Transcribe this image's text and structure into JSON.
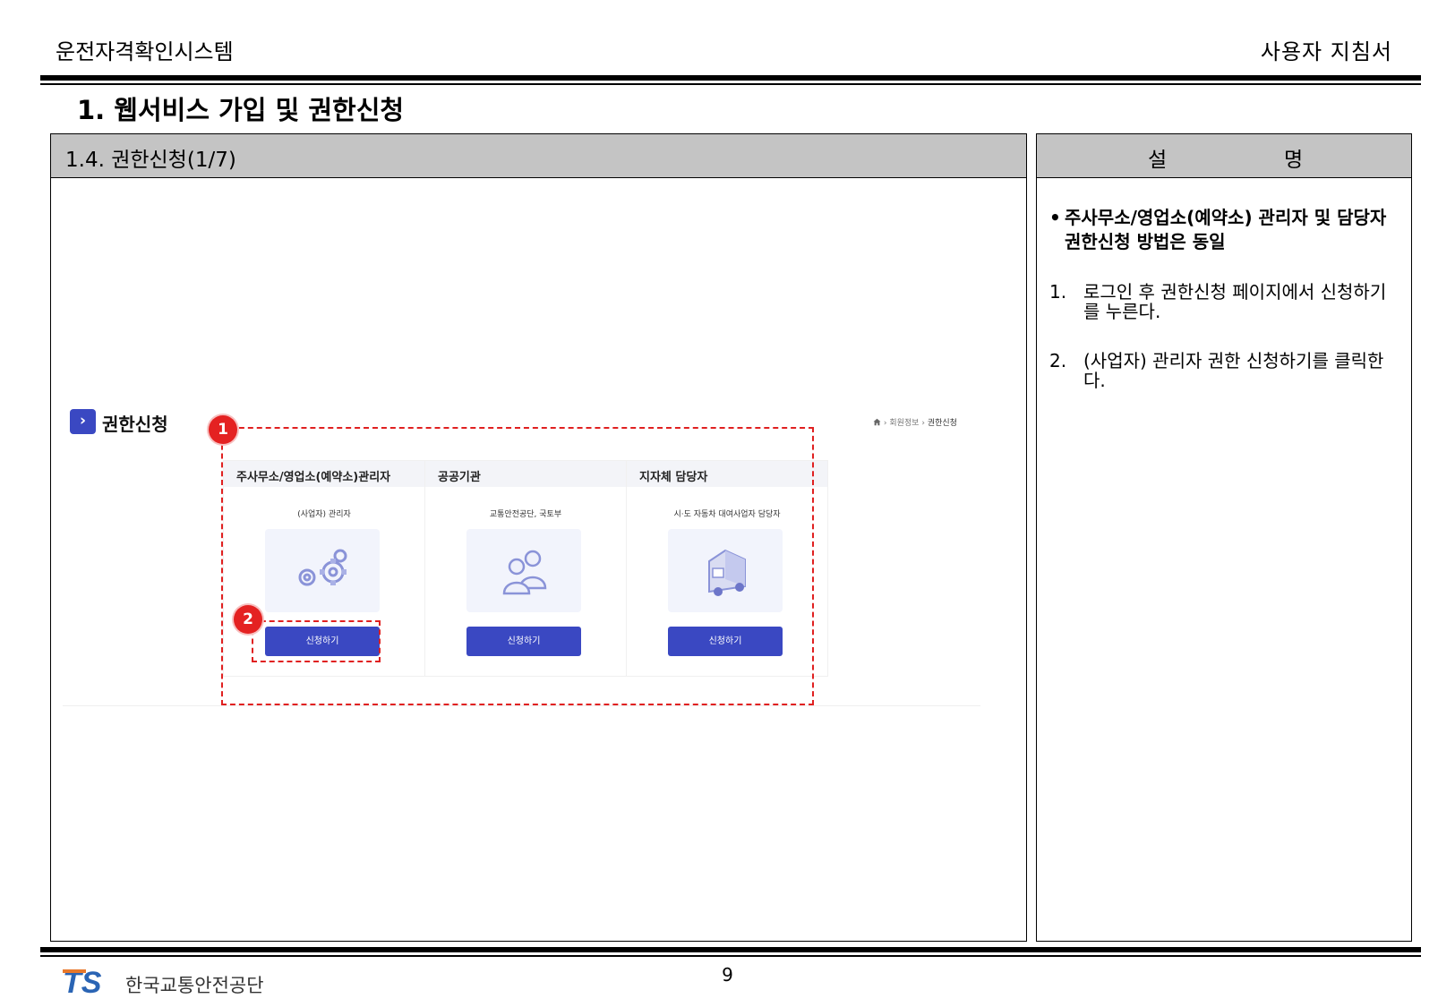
{
  "header": {
    "system_name": "운전자격확인시스템",
    "doc_title": "사용자 지침서"
  },
  "section": {
    "title": "1. 웹서비스 가입 및 권한신청"
  },
  "left_panel": {
    "header": "1.4. 권한신청(1/7)",
    "screenshot": {
      "title": "권한신청",
      "breadcrumb": {
        "level1": "회원정보",
        "current": "권한신청"
      },
      "cards": [
        {
          "title": "주사무소/영업소(예약소)관리자",
          "subtitle": "(사업자) 관리자",
          "button": "신청하기",
          "illustration": "gears-icon"
        },
        {
          "title": "공공기관",
          "subtitle": "교통안전공단, 국토부",
          "button": "신청하기",
          "illustration": "people-icon"
        },
        {
          "title": "지자체 담당자",
          "subtitle": "시·도 자동차 대여사업자 담당자",
          "button": "신청하기",
          "illustration": "vehicle-icon"
        }
      ],
      "markers": [
        "1",
        "2"
      ],
      "accent_color": "#3a48c2",
      "highlight_color": "#e02020"
    }
  },
  "right_panel": {
    "header_char1": "설",
    "header_char2": "명",
    "bullet": "주사무소/영업소(예약소) 관리자 및 담당자 권한신청 방법은 동일",
    "steps": [
      {
        "num": "1.",
        "text": "로그인 후 권한신청 페이지에서 신청하기를 누른다."
      },
      {
        "num": "2.",
        "text": "(사업자) 관리자 권한 신청하기를 클릭한다."
      }
    ]
  },
  "footer": {
    "org_logo_mark": "TS",
    "org_name": "한국교통안전공단",
    "page_number": "9"
  }
}
